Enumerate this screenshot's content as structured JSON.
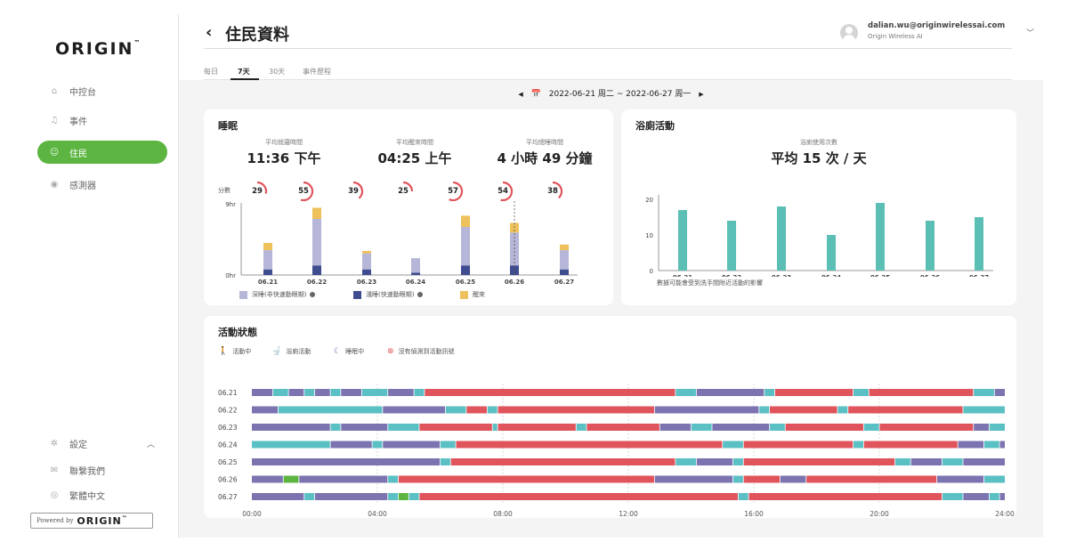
{
  "sidebar": {
    "logo": "ORIGIN",
    "logo_tm": "™",
    "items": [
      {
        "label": "中控台",
        "icon": "home-icon"
      },
      {
        "label": "事件",
        "icon": "bell-icon"
      },
      {
        "label": "住民",
        "icon": "people-icon"
      },
      {
        "label": "感測器",
        "icon": "sensor-icon"
      }
    ],
    "active": "住民",
    "bottom": [
      {
        "label": "設定",
        "icon": "gear-icon"
      },
      {
        "label": "聯繫我們",
        "icon": "mail-icon"
      },
      {
        "label": "繁體中文",
        "icon": "globe-icon"
      }
    ],
    "powered_by": "Powered by",
    "powered_logo": "ORIGIN",
    "powered_tm": "™"
  },
  "header": {
    "title": "住民資料",
    "user_email": "dalian.wu@originwirelessai.com",
    "user_org": "Origin Wireless AI"
  },
  "tabs": [
    "每日",
    "7天",
    "30天",
    "事件歷程"
  ],
  "active_tab": "7天",
  "date_range": "2022-06-21 周二 ~ 2022-06-27 周一",
  "sleep": {
    "title": "睡眠",
    "stats": [
      {
        "label": "平均就寢時間",
        "value": "11:36 下午"
      },
      {
        "label": "平均醒來時間",
        "value": "04:25 上午"
      },
      {
        "label": "平均總睡時間",
        "value": "4 小時 49 分鐘"
      }
    ],
    "score_label": "分數",
    "scores": [
      29,
      55,
      39,
      25,
      57,
      54,
      38
    ],
    "legend": [
      {
        "label": "深睡(非快速動眼期)",
        "color": "#b6b6d8"
      },
      {
        "label": "淺睡(快速動眼期)",
        "color": "#3f4c8f"
      },
      {
        "label": "醒來",
        "color": "#eec15a"
      }
    ]
  },
  "bathroom": {
    "title": "浴廁活動",
    "stat_label": "浴廁使用次數",
    "stat_value": "平均 15 次 / 天",
    "footnote": "數據可能會受到洗手間附近活動的影響"
  },
  "activity": {
    "title": "活動狀態",
    "legend": [
      {
        "label": "活動中",
        "icon": "walking-icon",
        "color": "#5cb541"
      },
      {
        "label": "浴廁活動",
        "icon": "toilet-icon",
        "color": "#4ab8c4"
      },
      {
        "label": "睡眠中",
        "icon": "sleep-icon",
        "color": "#7c74b0"
      },
      {
        "label": "沒有偵測到活動訊號",
        "icon": "no-signal-icon",
        "color": "#e0555c"
      }
    ],
    "rows": [
      "06.21",
      "06.22",
      "06.23",
      "06.24",
      "06.25",
      "06.26",
      "06.27"
    ],
    "time_ticks": [
      "00:00",
      "04:00",
      "08:00",
      "12:00",
      "16:00",
      "20:00",
      "24:00"
    ]
  },
  "chart_data": [
    {
      "type": "bar",
      "stacked": true,
      "categories": [
        "06.21",
        "06.22",
        "06.23",
        "06.24",
        "06.25",
        "06.26",
        "06.27"
      ],
      "series": [
        {
          "name": "淺睡(快速動眼期)",
          "values": [
            0.7,
            1.2,
            0.7,
            0.3,
            1.2,
            1.2,
            0.7
          ]
        },
        {
          "name": "深睡(非快速動眼期)",
          "values": [
            2.4,
            5.8,
            2.0,
            1.8,
            4.8,
            4.1,
            2.4
          ]
        },
        {
          "name": "醒來",
          "values": [
            0.9,
            1.4,
            0.3,
            0,
            1.4,
            1.2,
            0.7
          ]
        }
      ],
      "yticks": [
        "0hr",
        "9hr"
      ],
      "ylim": [
        0,
        9
      ],
      "colors": [
        "#3f4c8f",
        "#b6b6d8",
        "#eec15a"
      ]
    },
    {
      "type": "bar",
      "categories": [
        "06.21",
        "06.22",
        "06.23",
        "06.24",
        "06.25",
        "06.26",
        "06.27"
      ],
      "values": [
        17,
        14,
        18,
        10,
        19,
        14,
        15
      ],
      "ylim": [
        0,
        20
      ],
      "yticks": [
        0,
        10,
        20
      ],
      "color": "#5bbfb5"
    },
    {
      "type": "timeline",
      "categories": [
        "06.21",
        "06.22",
        "06.23",
        "06.24",
        "06.25",
        "06.26",
        "06.27"
      ],
      "xlim": [
        "00:00",
        "24:00"
      ],
      "states": {
        "A": "活動中",
        "B": "浴廁活動",
        "S": "睡眠中",
        "N": "沒有偵測到活動訊號"
      },
      "colors": {
        "A": "#5cb541",
        "B": "#5bc0c4",
        "S": "#7c74b0",
        "N": "#e0555c"
      },
      "rows": [
        [
          [
            "00:00",
            "S"
          ],
          [
            "00:40",
            "B"
          ],
          [
            "01:10",
            "S"
          ],
          [
            "01:40",
            "B"
          ],
          [
            "02:00",
            "S"
          ],
          [
            "02:30",
            "B"
          ],
          [
            "02:50",
            "S"
          ],
          [
            "03:30",
            "B"
          ],
          [
            "04:20",
            "S"
          ],
          [
            "05:10",
            "B"
          ],
          [
            "05:30",
            "N"
          ],
          [
            "13:30",
            "B"
          ],
          [
            "14:10",
            "S"
          ],
          [
            "16:20",
            "B"
          ],
          [
            "16:40",
            "N"
          ],
          [
            "19:10",
            "B"
          ],
          [
            "19:40",
            "N"
          ],
          [
            "23:00",
            "B"
          ],
          [
            "23:40",
            "S"
          ]
        ],
        [
          [
            "00:00",
            "S"
          ],
          [
            "00:50",
            "B"
          ],
          [
            "04:10",
            "S"
          ],
          [
            "06:10",
            "B"
          ],
          [
            "06:50",
            "N"
          ],
          [
            "07:30",
            "B"
          ],
          [
            "07:50",
            "N"
          ],
          [
            "12:50",
            "S"
          ],
          [
            "16:10",
            "B"
          ],
          [
            "16:30",
            "N"
          ],
          [
            "18:40",
            "B"
          ],
          [
            "19:00",
            "N"
          ],
          [
            "22:40",
            "B"
          ]
        ],
        [
          [
            "00:00",
            "S"
          ],
          [
            "02:30",
            "B"
          ],
          [
            "02:50",
            "S"
          ],
          [
            "04:20",
            "B"
          ],
          [
            "05:20",
            "N"
          ],
          [
            "07:40",
            "B"
          ],
          [
            "07:50",
            "N"
          ],
          [
            "10:20",
            "B"
          ],
          [
            "10:40",
            "N"
          ],
          [
            "13:00",
            "S"
          ],
          [
            "14:00",
            "B"
          ],
          [
            "14:40",
            "S"
          ],
          [
            "16:30",
            "B"
          ],
          [
            "17:00",
            "N"
          ],
          [
            "19:30",
            "B"
          ],
          [
            "20:00",
            "N"
          ],
          [
            "23:00",
            "S"
          ],
          [
            "23:30",
            "B"
          ]
        ],
        [
          [
            "00:00",
            "B"
          ],
          [
            "02:30",
            "S"
          ],
          [
            "03:50",
            "B"
          ],
          [
            "04:10",
            "S"
          ],
          [
            "06:00",
            "B"
          ],
          [
            "06:30",
            "N"
          ],
          [
            "15:00",
            "B"
          ],
          [
            "15:40",
            "N"
          ],
          [
            "19:10",
            "B"
          ],
          [
            "19:30",
            "N"
          ],
          [
            "22:30",
            "S"
          ],
          [
            "23:20",
            "B"
          ],
          [
            "23:50",
            "S"
          ]
        ],
        [
          [
            "00:00",
            "S"
          ],
          [
            "06:00",
            "B"
          ],
          [
            "06:20",
            "N"
          ],
          [
            "13:30",
            "B"
          ],
          [
            "14:10",
            "S"
          ],
          [
            "15:20",
            "B"
          ],
          [
            "15:40",
            "N"
          ],
          [
            "20:30",
            "B"
          ],
          [
            "21:00",
            "S"
          ],
          [
            "22:00",
            "B"
          ],
          [
            "22:40",
            "S"
          ]
        ],
        [
          [
            "00:00",
            "S"
          ],
          [
            "01:00",
            "A"
          ],
          [
            "01:30",
            "S"
          ],
          [
            "04:20",
            "B"
          ],
          [
            "04:40",
            "N"
          ],
          [
            "12:50",
            "S"
          ],
          [
            "15:20",
            "B"
          ],
          [
            "15:40",
            "N"
          ],
          [
            "16:50",
            "S"
          ],
          [
            "17:40",
            "N"
          ],
          [
            "21:50",
            "S"
          ],
          [
            "23:20",
            "B"
          ]
        ],
        [
          [
            "00:00",
            "S"
          ],
          [
            "01:40",
            "B"
          ],
          [
            "02:00",
            "S"
          ],
          [
            "04:20",
            "B"
          ],
          [
            "04:40",
            "A"
          ],
          [
            "05:00",
            "B"
          ],
          [
            "05:20",
            "N"
          ],
          [
            "15:30",
            "B"
          ],
          [
            "15:50",
            "N"
          ],
          [
            "22:00",
            "B"
          ],
          [
            "22:40",
            "S"
          ],
          [
            "23:30",
            "B"
          ],
          [
            "23:50",
            "S"
          ]
        ]
      ]
    }
  ]
}
